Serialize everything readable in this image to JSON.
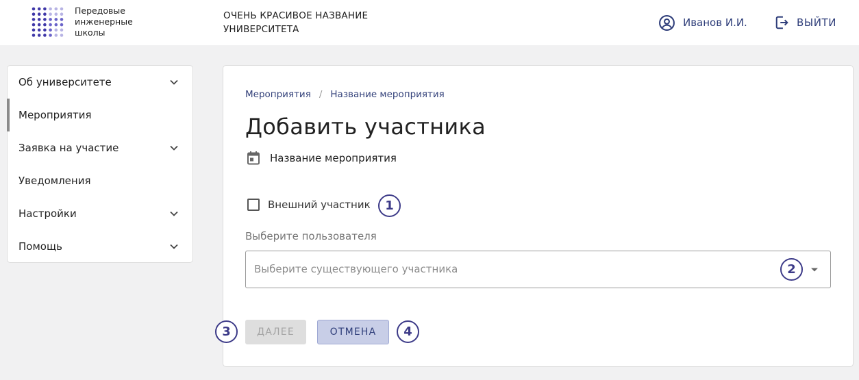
{
  "header": {
    "logo_lines": [
      "Передовые",
      "инженерные",
      "школы"
    ],
    "university_title_line1": "ОЧЕНЬ КРАСИВОЕ НАЗВАНИЕ",
    "university_title_line2": "УНИВЕРСИТЕТА",
    "user_name": "Иванов И.И.",
    "logout_label": "ВЫЙТИ",
    "user_icon": "account-circle-icon",
    "logout_icon": "logout-icon"
  },
  "sidebar": {
    "items": [
      {
        "label": "Об университете",
        "has_chevron": true,
        "active": false
      },
      {
        "label": "Мероприятия",
        "has_chevron": false,
        "active": true
      },
      {
        "label": "Заявка на участие",
        "has_chevron": true,
        "active": false
      },
      {
        "label": "Уведомления",
        "has_chevron": false,
        "active": false
      },
      {
        "label": "Настройки",
        "has_chevron": true,
        "active": false
      },
      {
        "label": "Помощь",
        "has_chevron": true,
        "active": false
      }
    ]
  },
  "main": {
    "breadcrumbs": [
      "Мероприятия",
      "Название мероприятия"
    ],
    "breadcrumb_separator": "/",
    "title": "Добавить участника",
    "event_name": "Название мероприятия",
    "event_icon": "calendar-icon",
    "external_checkbox_label": "Внешний участник",
    "external_checkbox_checked": false,
    "user_field_label": "Выберите пользователя",
    "user_select_placeholder": "Выберите существующего участника",
    "next_button": "ДАЛЕЕ",
    "next_button_disabled": true,
    "cancel_button": "ОТМЕНА"
  },
  "annotations": [
    "1",
    "2",
    "3",
    "4"
  ],
  "colors": {
    "accent": "#2f3e7a",
    "badge": "#3c3a88",
    "page_bg": "#f1f1f2",
    "cancel_bg": "#c8cee7",
    "disabled_bg": "#dedede"
  }
}
